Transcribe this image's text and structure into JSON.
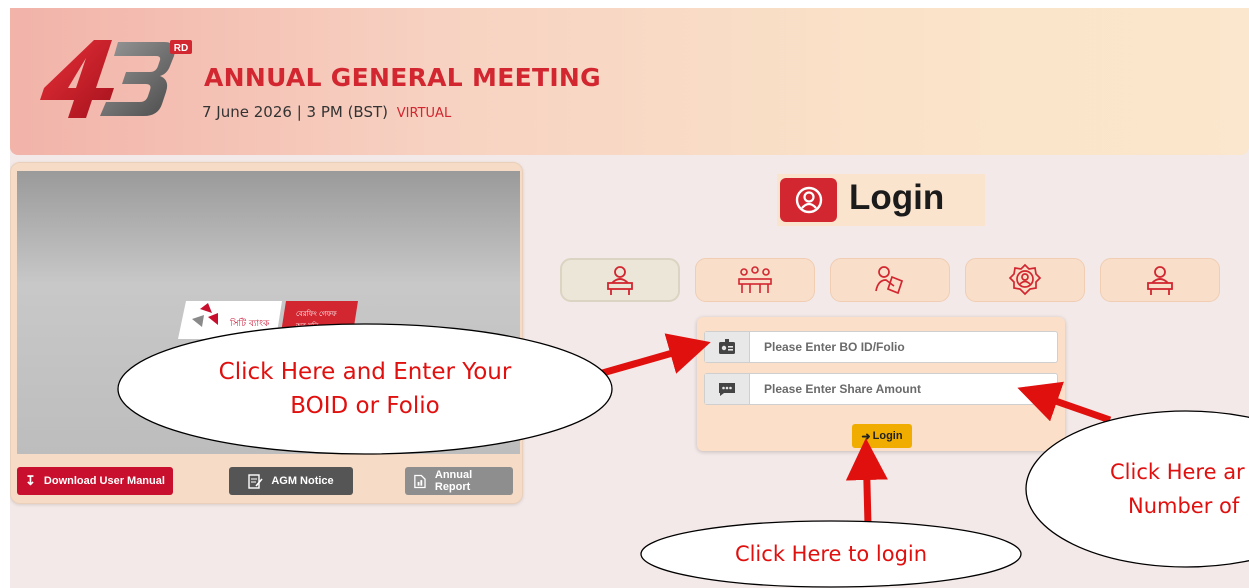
{
  "header": {
    "ordinal_number": "43",
    "ordinal_suffix": "RD",
    "title": "ANNUAL GENERAL MEETING",
    "date_time": "7 June 2026 | 3 PM (BST)",
    "mode": "VIRTUAL"
  },
  "video": {
    "brand_bengali": "সিটি ব্যাংক",
    "tagline_line1": "বেরফিং গেফফ",
    "tagline_line2": "অব মনি"
  },
  "buttons": {
    "download": "Download User Manual",
    "agm_notice": "AGM Notice",
    "annual_report": "Annual Report"
  },
  "login": {
    "title": "Login",
    "tabs": [
      {
        "icon": "shareholder-desk-icon"
      },
      {
        "icon": "board-meeting-icon"
      },
      {
        "icon": "hand-with-document-icon"
      },
      {
        "icon": "settings-user-icon"
      },
      {
        "icon": "person-at-desk-icon"
      }
    ],
    "boid_placeholder": "Please Enter BO ID/Folio",
    "share_placeholder": "Please Enter Share Amount",
    "submit_label": "Login"
  },
  "annotations": {
    "boid_line1": "Click Here and Enter Your",
    "boid_line2": "BOID or Folio",
    "login_note": "Click Here to login",
    "share_line1": "Click Here ar",
    "share_line2": "Number of"
  },
  "colors": {
    "brand_red": "#d22630",
    "login_button": "#f0ad00",
    "annotation_text": "#e0100f"
  }
}
